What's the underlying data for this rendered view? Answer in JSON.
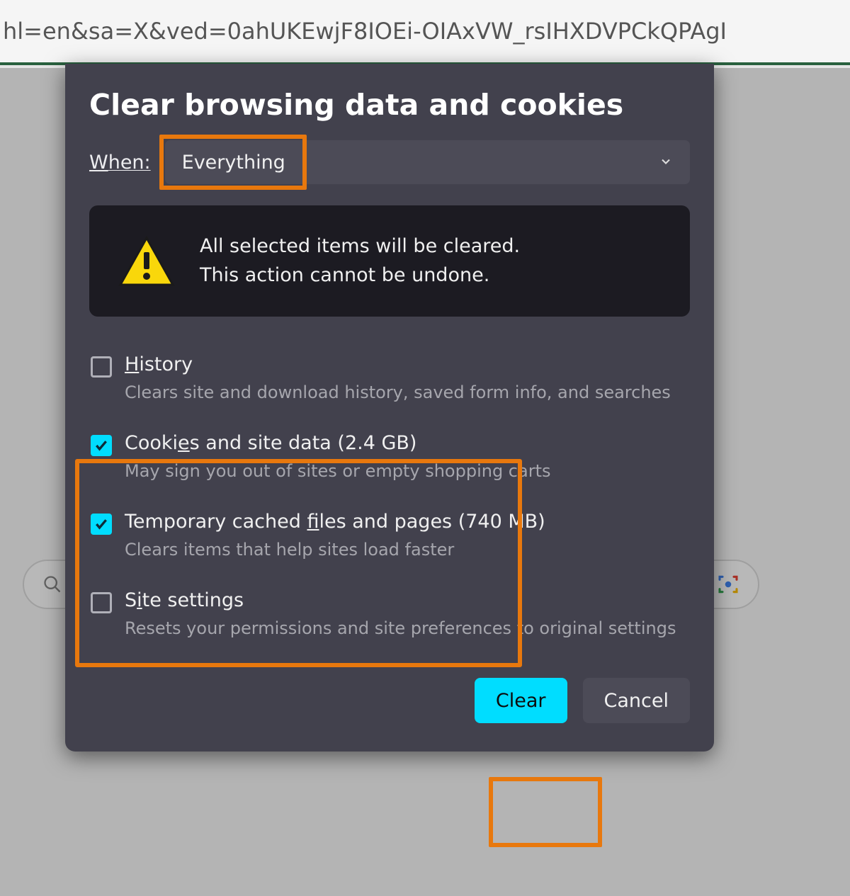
{
  "url_fragment": "hl=en&sa=X&ved=0ahUKEwjF8IOEi-OIAxVW_rsIHXDVPCkQPAgI",
  "dialog": {
    "title": "Clear browsing data and cookies",
    "when_label": "When:",
    "when_selected": "Everything",
    "warning_line1": "All selected items will be cleared.",
    "warning_line2": "This action cannot be undone."
  },
  "options": [
    {
      "checked": false,
      "label_pre": "",
      "label_ul": "H",
      "label_post": "istory",
      "desc": "Clears site and download history, saved form info, and searches"
    },
    {
      "checked": true,
      "label_pre": "Cooki",
      "label_ul": "e",
      "label_post": "s and site data (2.4 GB)",
      "desc": "May sign you out of sites or empty shopping carts"
    },
    {
      "checked": true,
      "label_pre": "Temporary cached ",
      "label_ul": "f",
      "label_post": "iles and pages (740 MB)",
      "desc": "Clears items that help sites load faster"
    },
    {
      "checked": false,
      "label_pre": "S",
      "label_ul": "i",
      "label_post": "te settings",
      "desc": "Resets your permissions and site preferences to original settings"
    }
  ],
  "buttons": {
    "primary": "Clear",
    "secondary": "Cancel"
  }
}
